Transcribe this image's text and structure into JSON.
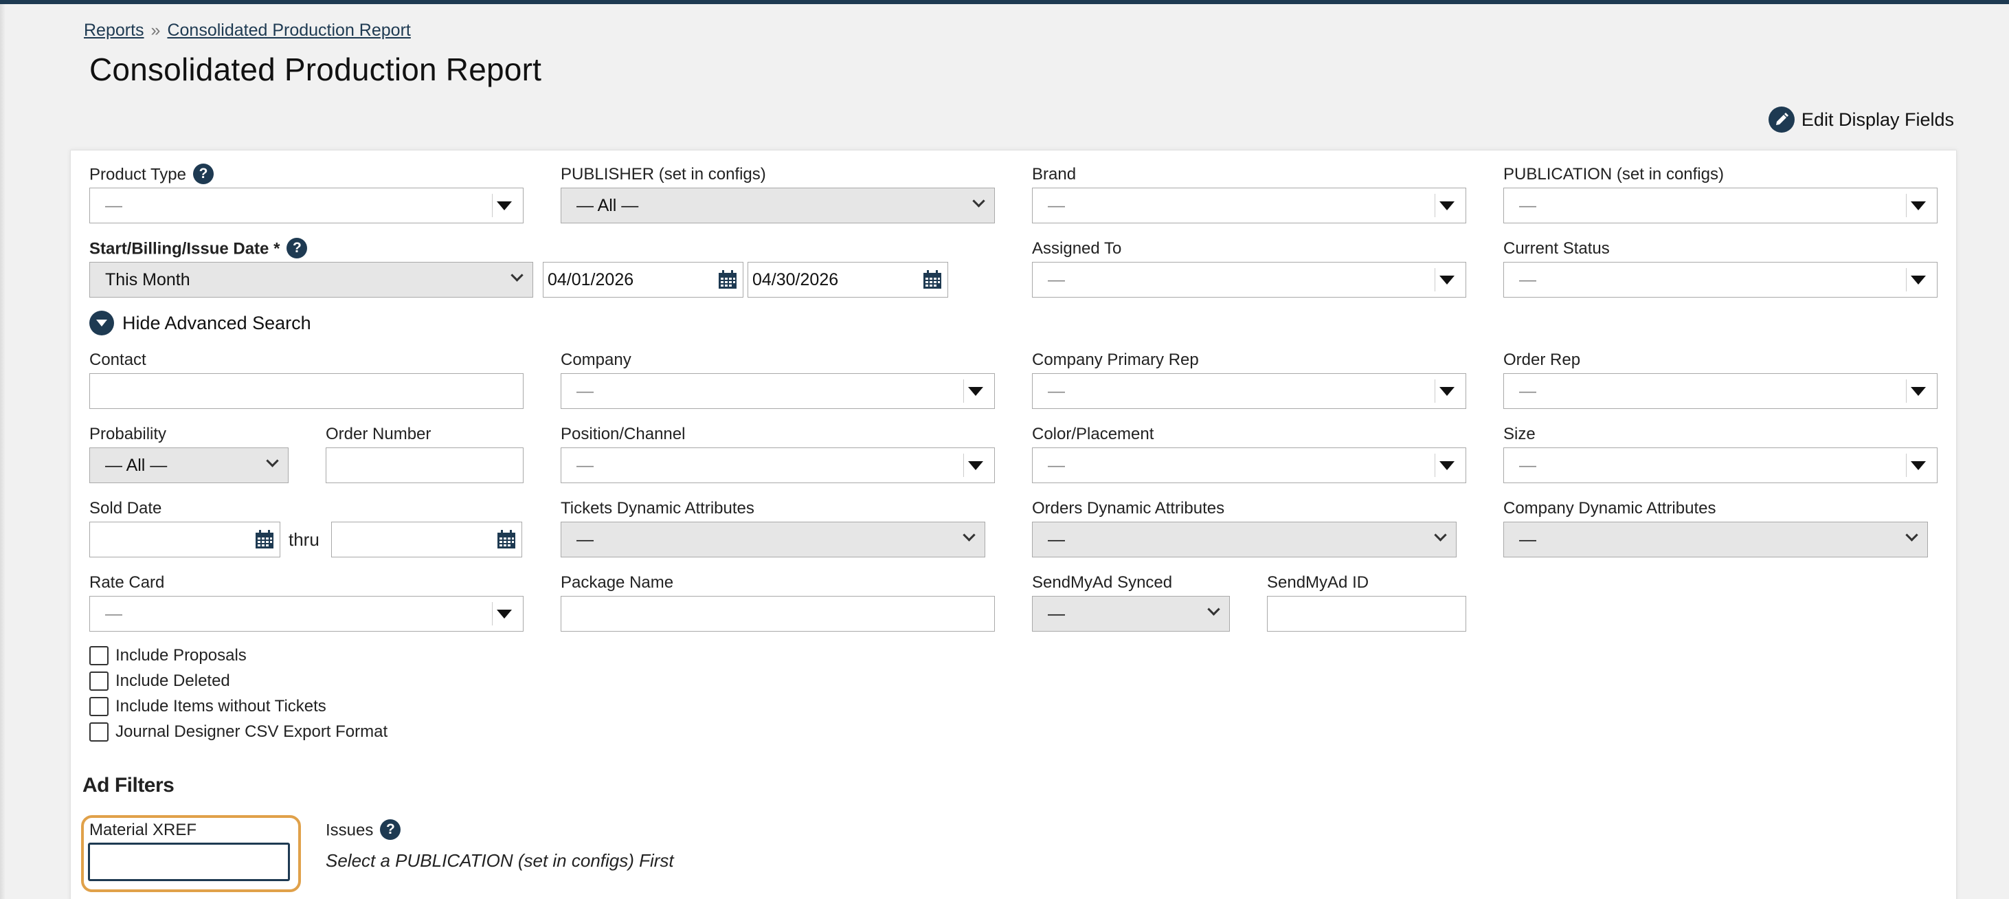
{
  "breadcrumb": {
    "reports": "Reports",
    "sep": "»",
    "current": "Consolidated Production Report"
  },
  "page": {
    "title": "Consolidated Production Report",
    "edit_display_fields": "Edit Display Fields"
  },
  "filters": {
    "product_type": {
      "label": "Product Type",
      "value": "—"
    },
    "publisher": {
      "label": "PUBLISHER (set in configs)",
      "value": "— All —"
    },
    "brand": {
      "label": "Brand",
      "value": "—"
    },
    "publication": {
      "label": "PUBLICATION (set in configs)",
      "value": "—"
    },
    "date_range": {
      "label": "Start/Billing/Issue Date *",
      "value": "This Month",
      "start": "04/01/2026",
      "end": "04/30/2026"
    },
    "assigned_to": {
      "label": "Assigned To",
      "value": "—"
    },
    "current_status": {
      "label": "Current Status",
      "value": "—"
    }
  },
  "advanced": {
    "toggle_label": "Hide Advanced Search",
    "contact": {
      "label": "Contact",
      "value": ""
    },
    "company": {
      "label": "Company",
      "value": "—"
    },
    "company_primary_rep": {
      "label": "Company Primary Rep",
      "value": "—"
    },
    "order_rep": {
      "label": "Order Rep",
      "value": "—"
    },
    "probability": {
      "label": "Probability",
      "value": "— All —"
    },
    "order_number": {
      "label": "Order Number",
      "value": ""
    },
    "position_channel": {
      "label": "Position/Channel",
      "value": "—"
    },
    "color_placement": {
      "label": "Color/Placement",
      "value": "—"
    },
    "size": {
      "label": "Size",
      "value": "—"
    },
    "sold_date": {
      "label": "Sold Date",
      "thru": "thru"
    },
    "tickets_dynamic": {
      "label": "Tickets Dynamic Attributes",
      "value": "—"
    },
    "orders_dynamic": {
      "label": "Orders Dynamic Attributes",
      "value": "—"
    },
    "company_dynamic": {
      "label": "Company Dynamic Attributes",
      "value": "—"
    },
    "rate_card": {
      "label": "Rate Card",
      "value": "—"
    },
    "package_name": {
      "label": "Package Name",
      "value": ""
    },
    "sendmyad_synced": {
      "label": "SendMyAd Synced",
      "value": "—"
    },
    "sendmyad_id": {
      "label": "SendMyAd ID",
      "value": ""
    }
  },
  "checkboxes": [
    {
      "label": "Include Proposals",
      "checked": false
    },
    {
      "label": "Include Deleted",
      "checked": false
    },
    {
      "label": "Include Items without Tickets",
      "checked": false
    },
    {
      "label": "Journal Designer CSV Export Format",
      "checked": false
    }
  ],
  "ad_filters": {
    "title": "Ad Filters",
    "material_xref": {
      "label": "Material XREF",
      "value": ""
    },
    "issues": {
      "label": "Issues",
      "hint": "Select a PUBLICATION (set in configs) First"
    }
  },
  "colors": {
    "brand": "#1e3a52",
    "focus": "#e0a14a",
    "background": "#f1f1f1"
  }
}
